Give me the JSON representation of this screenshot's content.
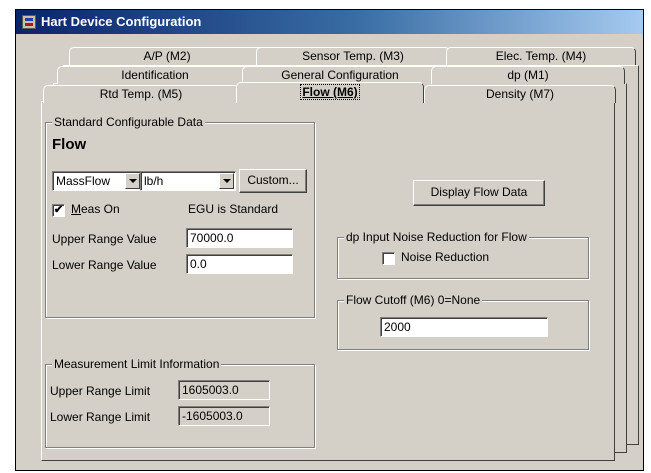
{
  "window": {
    "title": "Hart Device Configuration"
  },
  "tabs": {
    "row1": [
      "A/P (M2)",
      "Sensor Temp. (M3)",
      "Elec. Temp. (M4)"
    ],
    "row2": [
      "Identification",
      "General Configuration",
      "dp (M1)"
    ],
    "row3": [
      "Rtd Temp. (M5)",
      "Flow (M6)",
      "Density (M7)"
    ],
    "active": "Flow (M6)"
  },
  "standard": {
    "group_label": "Standard Configurable Data",
    "heading": "Flow",
    "flow_type_value": "MassFlow",
    "unit_value": "lb/h",
    "custom_button": "Custom...",
    "meas_on_label": "Meas On",
    "meas_on_checked_mark": "✔",
    "egu_text": "EGU is Standard",
    "urv_label": "Upper Range Value",
    "urv_value": "70000.0",
    "lrv_label": "Lower Range Value",
    "lrv_value": "0.0"
  },
  "display_button": "Display Flow Data",
  "noise": {
    "group_label": "dp Input Noise Reduction for Flow",
    "checkbox_label": "Noise Reduction",
    "checked": false
  },
  "cutoff": {
    "group_label": "Flow Cutoff (M6)  0=None",
    "value": "2000"
  },
  "limits": {
    "group_label": "Measurement Limit Information",
    "url_label": "Upper Range Limit",
    "url_value": "1605003.0",
    "lrl_label": "Lower Range Limit",
    "lrl_value": "-1605003.0"
  }
}
